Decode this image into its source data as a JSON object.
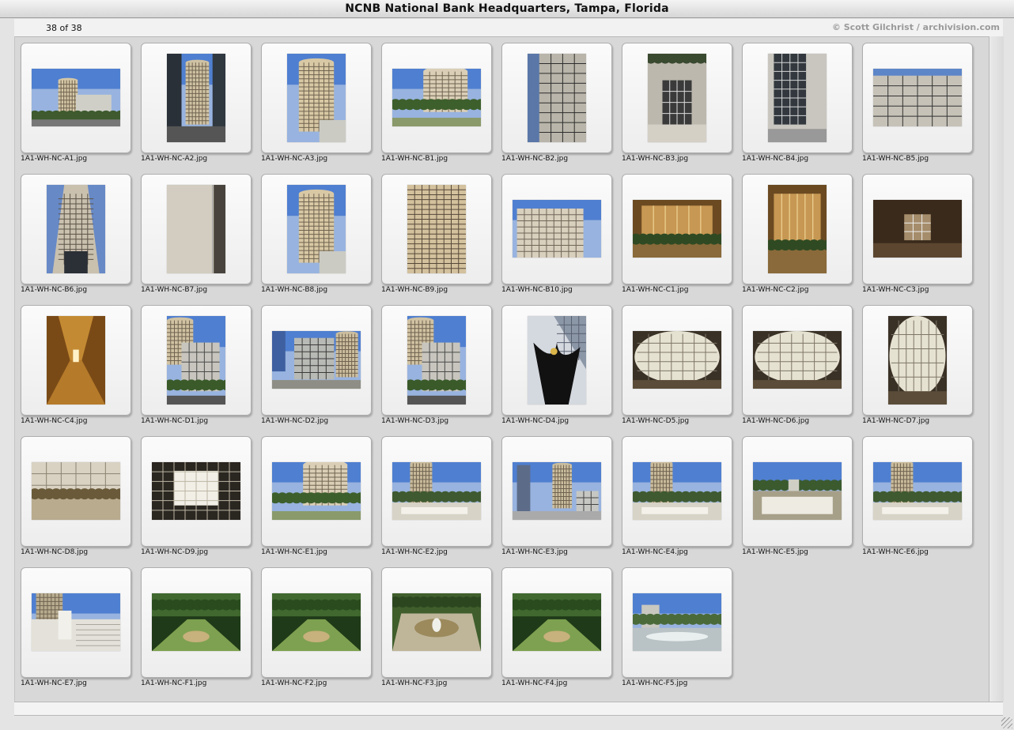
{
  "window": {
    "title": "NCNB National Bank Headquarters, Tampa, Florida"
  },
  "info": {
    "count": "38 of 38",
    "credit": "© Scott Gilchrist / archivision.com"
  },
  "thumbnails": [
    {
      "file": "1A1-WH-NC-A1.jpg",
      "orientation": "land",
      "scene": "tower-wide"
    },
    {
      "file": "1A1-WH-NC-A2.jpg",
      "orientation": "port",
      "scene": "tower-street"
    },
    {
      "file": "1A1-WH-NC-A3.jpg",
      "orientation": "port",
      "scene": "tower-sky"
    },
    {
      "file": "1A1-WH-NC-B1.jpg",
      "orientation": "land",
      "scene": "tower-trees"
    },
    {
      "file": "1A1-WH-NC-B2.jpg",
      "orientation": "port",
      "scene": "facade-dark"
    },
    {
      "file": "1A1-WH-NC-B3.jpg",
      "orientation": "port",
      "scene": "entrance"
    },
    {
      "file": "1A1-WH-NC-B4.jpg",
      "orientation": "port",
      "scene": "glass-facade"
    },
    {
      "file": "1A1-WH-NC-B5.jpg",
      "orientation": "land",
      "scene": "facade-grid"
    },
    {
      "file": "1A1-WH-NC-B6.jpg",
      "orientation": "port",
      "scene": "tower-up"
    },
    {
      "file": "1A1-WH-NC-B7.jpg",
      "orientation": "port",
      "scene": "stone"
    },
    {
      "file": "1A1-WH-NC-B8.jpg",
      "orientation": "port",
      "scene": "tower-sky"
    },
    {
      "file": "1A1-WH-NC-B9.jpg",
      "orientation": "port",
      "scene": "facade-beige"
    },
    {
      "file": "1A1-WH-NC-B10.jpg",
      "orientation": "land",
      "scene": "tower-top"
    },
    {
      "file": "1A1-WH-NC-C1.jpg",
      "orientation": "land",
      "scene": "interior-gold"
    },
    {
      "file": "1A1-WH-NC-C2.jpg",
      "orientation": "port",
      "scene": "interior-gold"
    },
    {
      "file": "1A1-WH-NC-C3.jpg",
      "orientation": "land",
      "scene": "interior-dark"
    },
    {
      "file": "1A1-WH-NC-C4.jpg",
      "orientation": "port",
      "scene": "corridor"
    },
    {
      "file": "1A1-WH-NC-D1.jpg",
      "orientation": "port",
      "scene": "tower-palms"
    },
    {
      "file": "1A1-WH-NC-D2.jpg",
      "orientation": "land",
      "scene": "glass-block"
    },
    {
      "file": "1A1-WH-NC-D3.jpg",
      "orientation": "port",
      "scene": "tower-palms"
    },
    {
      "file": "1A1-WH-NC-D4.jpg",
      "orientation": "port",
      "scene": "sculpture"
    },
    {
      "file": "1A1-WH-NC-D5.jpg",
      "orientation": "land",
      "scene": "atrium"
    },
    {
      "file": "1A1-WH-NC-D6.jpg",
      "orientation": "land",
      "scene": "atrium"
    },
    {
      "file": "1A1-WH-NC-D7.jpg",
      "orientation": "port",
      "scene": "atrium"
    },
    {
      "file": "1A1-WH-NC-D8.jpg",
      "orientation": "land",
      "scene": "hall-white"
    },
    {
      "file": "1A1-WH-NC-D9.jpg",
      "orientation": "land",
      "scene": "skylight"
    },
    {
      "file": "1A1-WH-NC-E1.jpg",
      "orientation": "land",
      "scene": "tower-trees"
    },
    {
      "file": "1A1-WH-NC-E2.jpg",
      "orientation": "land",
      "scene": "plaza"
    },
    {
      "file": "1A1-WH-NC-E3.jpg",
      "orientation": "land",
      "scene": "city-towers"
    },
    {
      "file": "1A1-WH-NC-E4.jpg",
      "orientation": "land",
      "scene": "plaza"
    },
    {
      "file": "1A1-WH-NC-E5.jpg",
      "orientation": "land",
      "scene": "plaza-wide"
    },
    {
      "file": "1A1-WH-NC-E6.jpg",
      "orientation": "land",
      "scene": "plaza"
    },
    {
      "file": "1A1-WH-NC-E7.jpg",
      "orientation": "land",
      "scene": "steps"
    },
    {
      "file": "1A1-WH-NC-F1.jpg",
      "orientation": "land",
      "scene": "garden"
    },
    {
      "file": "1A1-WH-NC-F2.jpg",
      "orientation": "land",
      "scene": "garden"
    },
    {
      "file": "1A1-WH-NC-F3.jpg",
      "orientation": "land",
      "scene": "fountain"
    },
    {
      "file": "1A1-WH-NC-F4.jpg",
      "orientation": "land",
      "scene": "garden"
    },
    {
      "file": "1A1-WH-NC-F5.jpg",
      "orientation": "land",
      "scene": "fountain-city"
    }
  ]
}
